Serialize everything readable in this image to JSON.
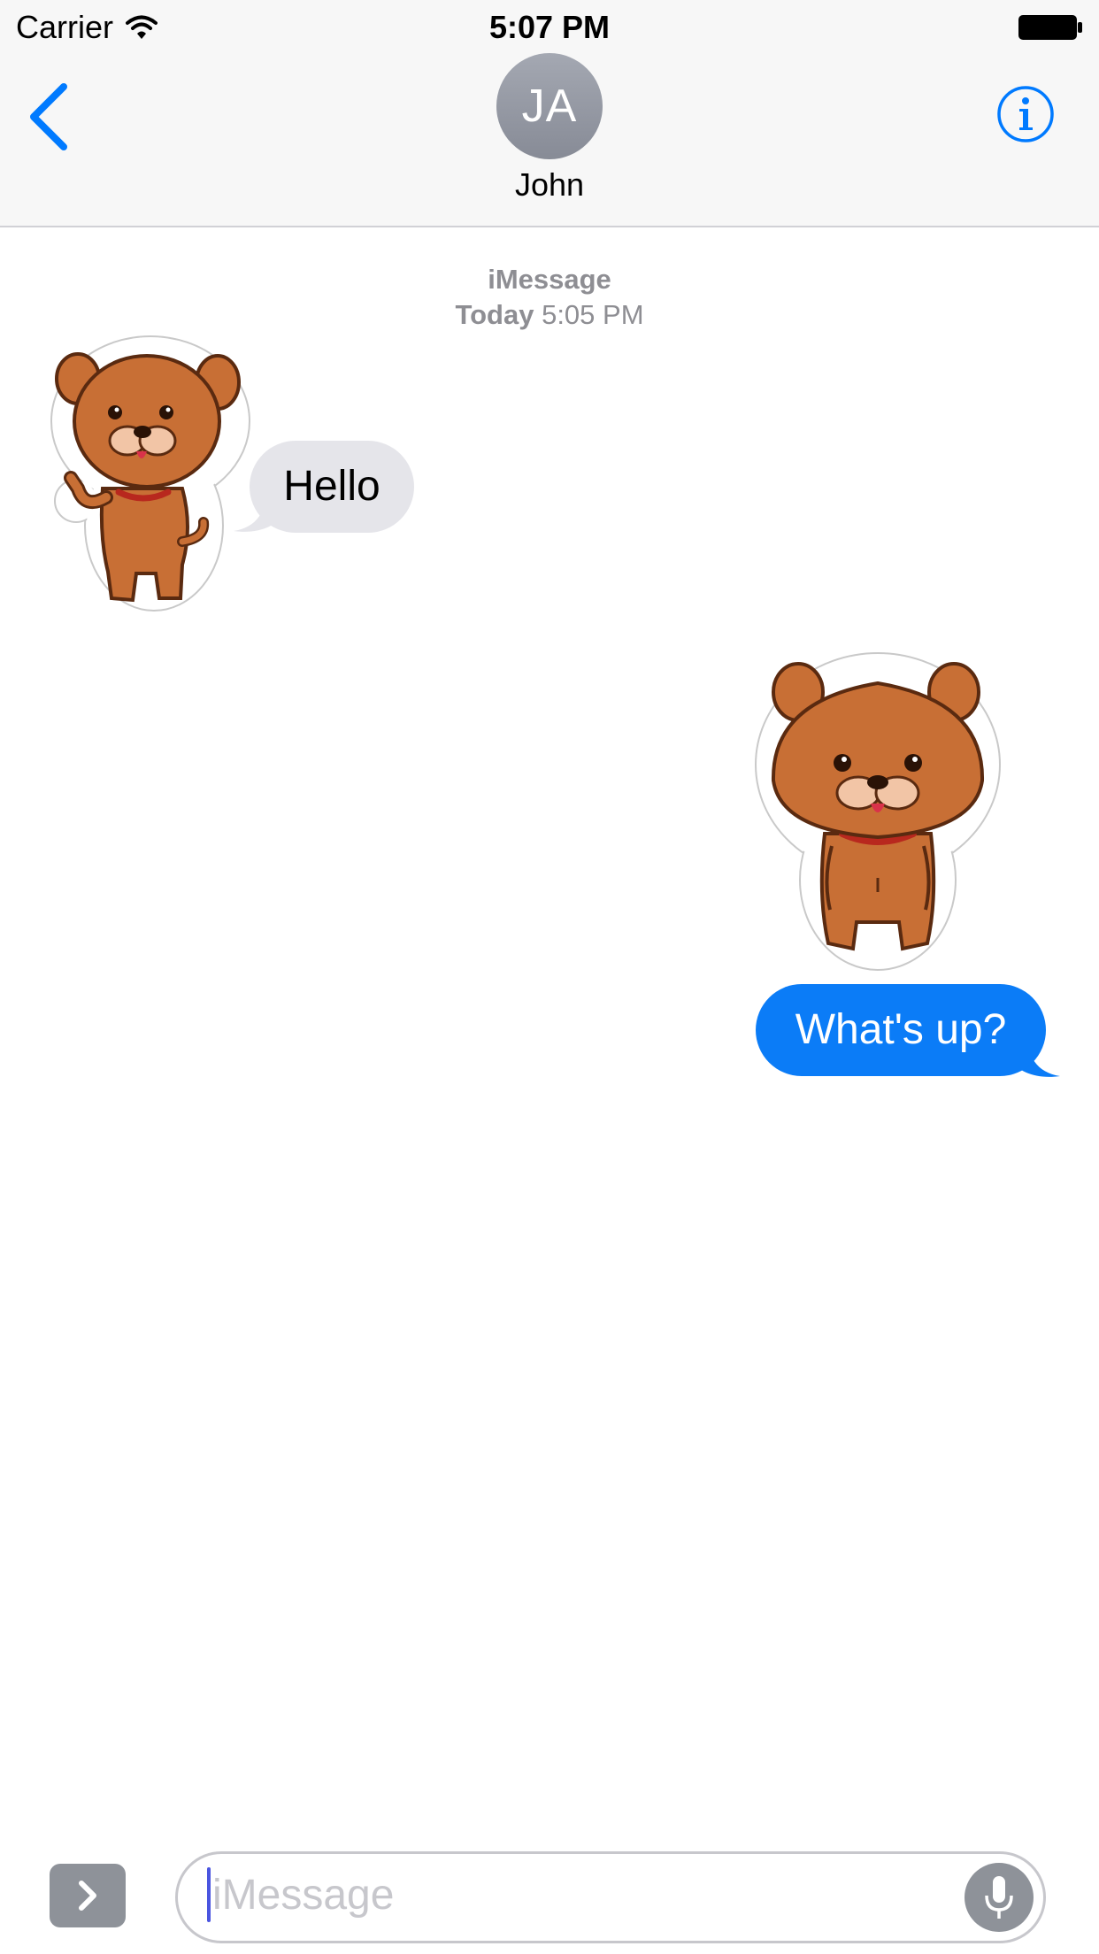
{
  "status_bar": {
    "carrier": "Carrier",
    "time": "5:07 PM"
  },
  "nav": {
    "avatar_initials": "JA",
    "contact_name": "John"
  },
  "conversation": {
    "service_label": "iMessage",
    "timestamp_day": "Today",
    "timestamp_time": "5:05 PM",
    "messages": [
      {
        "direction": "incoming",
        "type": "sticker",
        "sticker": "puppy-waving"
      },
      {
        "direction": "incoming",
        "type": "text",
        "text": "Hello"
      },
      {
        "direction": "outgoing",
        "type": "sticker",
        "sticker": "puppy-standing"
      },
      {
        "direction": "outgoing",
        "type": "text",
        "text": "What's up?"
      }
    ]
  },
  "input_bar": {
    "placeholder": "iMessage"
  },
  "icons": {
    "back": "chevron-left-icon",
    "info": "info-icon",
    "wifi": "wifi-icon",
    "battery": "battery-icon",
    "apps": "chevron-right-icon",
    "mic": "microphone-icon"
  },
  "colors": {
    "accent": "#007aff",
    "outgoing_bubble": "#0b7cf7",
    "incoming_bubble": "#e5e5ea",
    "secondary_text": "#8e8e93",
    "sticker_fur": "#c86f35"
  }
}
